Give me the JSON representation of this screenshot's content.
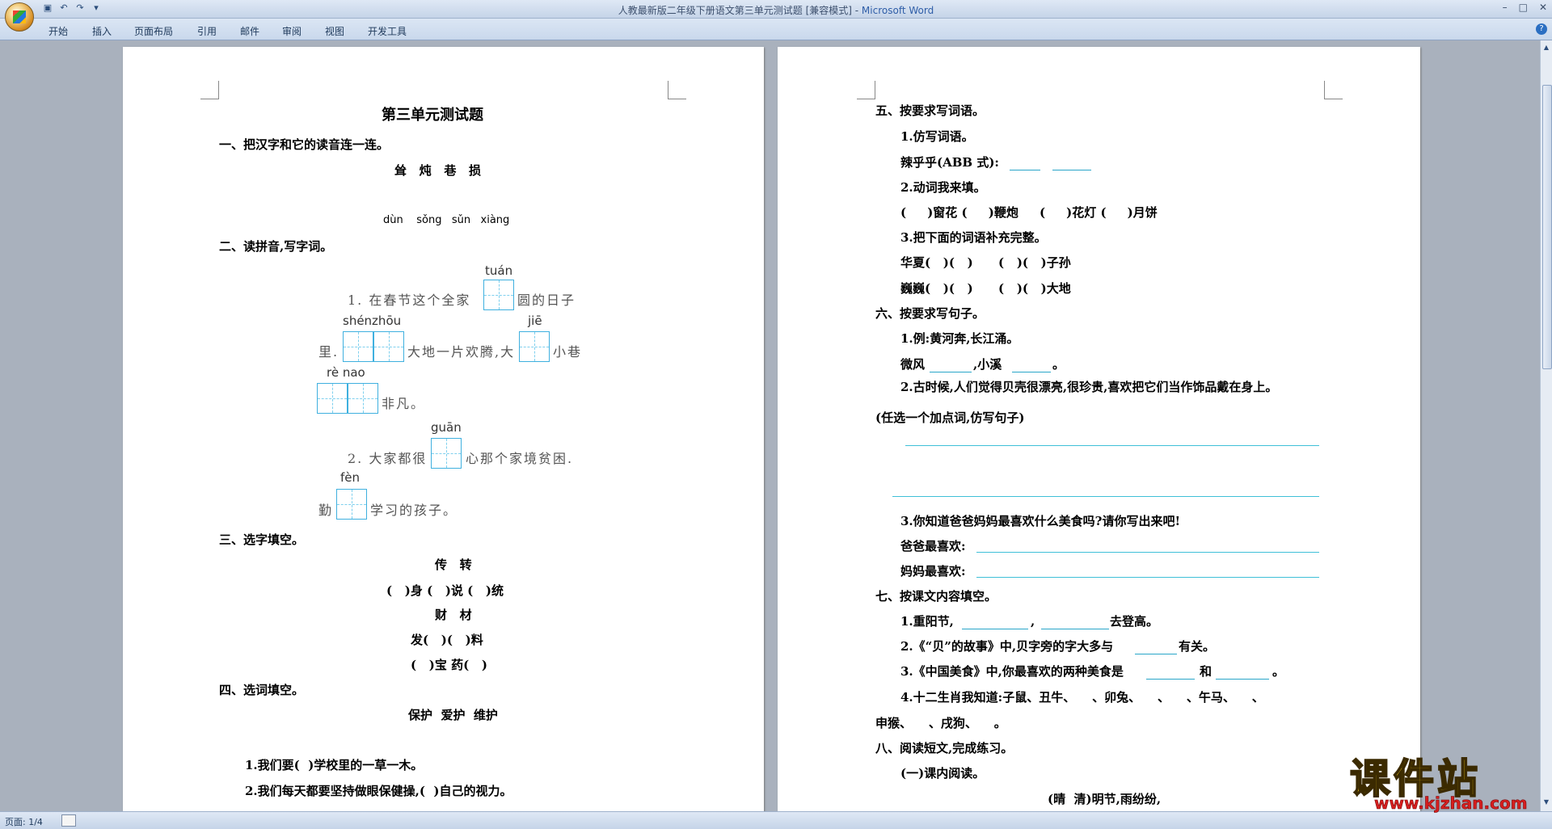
{
  "window": {
    "title": "人教最新版二年级下册语文第三单元测试题 [兼容模式] - ",
    "app_name": "Microsoft Word",
    "controls": [
      "–",
      "□",
      "✕"
    ]
  },
  "ribbon": {
    "tabs": [
      "开始",
      "插入",
      "页面布局",
      "引用",
      "邮件",
      "审阅",
      "视图",
      "开发工具"
    ],
    "help": "?"
  },
  "status": {
    "page": "页面: 1/4"
  },
  "page1": {
    "title": "第三单元测试题",
    "s1_heading": "一、把汉字和它的读音连一连。",
    "s1_chars": "耸   炖   巷   损",
    "s1_pinyin": "dùn    sǒng   sǔn   xiàng",
    "s2_heading": "二、读拼音,写字词。",
    "s2_py1": "tuán",
    "s2_line1a": "1. 在春节这个全家",
    "s2_line1b": "圆的日子",
    "s2_py2": "shénzhōu",
    "s2_py3": "jiē",
    "s2_line2a": "里.",
    "s2_line2b": "大地一片欢腾,大",
    "s2_line2c": "小巷",
    "s2_py4": "rè  nao",
    "s2_line3": "非凡。",
    "s2_py5": "guān",
    "s2_line4a": "2. 大家都很",
    "s2_line4b": "心那个家境贫困.",
    "s2_py6": "fèn",
    "s2_line5a": "勤",
    "s2_line5b": "学习的孩子。",
    "s3_heading": "三、选字填空。",
    "s3_pair1": "传   转",
    "s3_line1": "(   )身 (   )说 (   )统",
    "s3_pair2": "财   材",
    "s3_line2": "发(   )(   )料",
    "s3_line3": "(   )宝 药(   )",
    "s4_heading": "四、选词填空。",
    "s4_words": "保护  爱护  维护",
    "s4_q1": "1.我们要(  )学校里的一草一木。",
    "s4_q2": "2.我们每天都要坚持做眼保健操,(  )自己的视力。"
  },
  "page2": {
    "s5_heading": "五、按要求写词语。",
    "s5_q1": "1.仿写词语。",
    "s5_q1_ex": "辣乎乎(ABB 式):",
    "s5_q2": "2.动词我来填。",
    "s5_q2_line": "(     )窗花 (     )鞭炮     (     )花灯 (     )月饼",
    "s5_q3": "3.把下面的词语补充完整。",
    "s5_q3_l1": "华夏(   )(   )      (   )(   )子孙",
    "s5_q3_l2": "巍巍(   )(   )      (   )(   )大地",
    "s6_heading": "六、按要求写句子。",
    "s6_q1": "1.例:黄河奔,长江涌。",
    "s6_q1_a": "微风",
    "s6_q1_b": ",小溪",
    "s6_q1_c": "。",
    "s6_q2": "2.古时候,人们觉得贝壳很漂亮,很珍贵,喜欢把它们当作饰品戴在身上。",
    "s6_q2_b": "(任选一个加点词,仿写句子)",
    "s6_q3": "3.你知道爸爸妈妈最喜欢什么美食吗?请你写出来吧!",
    "s6_q3_dad": "爸爸最喜欢:",
    "s6_q3_mom": "妈妈最喜欢:",
    "s7_heading": "七、按课文内容填空。",
    "s7_q1_a": "1.重阳节,",
    "s7_q1_b": ",",
    "s7_q1_c": "去登高。",
    "s7_q2_a": "2.《“贝”的故事》中,贝字旁的字大多与",
    "s7_q2_b": "有关。",
    "s7_q3_a": "3.《中国美食》中,你最喜欢的两种美食是",
    "s7_q3_b": "和",
    "s7_q3_c": "。",
    "s7_q4": "4.十二生肖我知道:子鼠、丑牛、    、卯兔、    、    、午马、    、",
    "s7_q4_b": "申猴、    、戌狗、    。",
    "s8_heading": "八、阅读短文,完成练习。",
    "s8_sub": "(一)课内阅读。",
    "s8_line": "(晴  清)明节,雨纷纷,"
  },
  "watermark": {
    "cn": "课件站",
    "en": "www.kjzhan.com"
  },
  "colors": {
    "accent": "#2aa6c9",
    "workspace": "#a9b1bd",
    "ribbon": "#c9d8ec"
  }
}
